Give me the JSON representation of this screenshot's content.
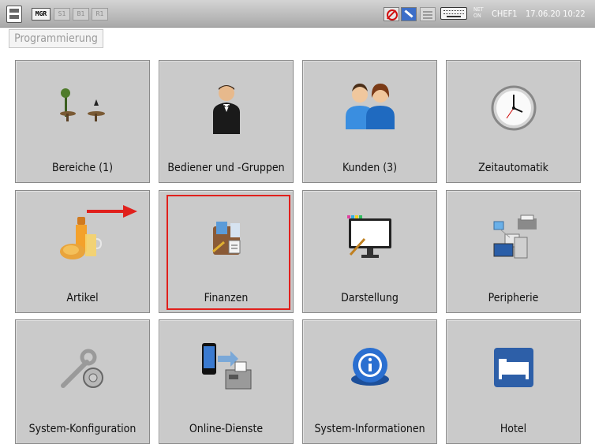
{
  "topbar": {
    "modes": [
      {
        "label": "MGR",
        "active": true
      },
      {
        "label": "S1",
        "active": false
      },
      {
        "label": "B1",
        "active": false
      },
      {
        "label": "R1",
        "active": false
      }
    ],
    "net_status": "NET ON",
    "user": "CHEF1",
    "datetime": "17.06.20  10:22"
  },
  "section_label": "Programmierung",
  "tiles": [
    {
      "label": "Bereiche (1)",
      "icon": "tables-icon"
    },
    {
      "label": "Bediener und -Gruppen",
      "icon": "waiter-icon"
    },
    {
      "label": "Kunden (3)",
      "icon": "customers-icon"
    },
    {
      "label": "Zeitautomatik",
      "icon": "clock-icon"
    },
    {
      "label": "Artikel",
      "icon": "food-drink-icon"
    },
    {
      "label": "Finanzen",
      "icon": "finance-icon"
    },
    {
      "label": "Darstellung",
      "icon": "display-icon"
    },
    {
      "label": "Peripherie",
      "icon": "peripherals-icon"
    },
    {
      "label": "System-Konfiguration",
      "icon": "tools-gear-icon"
    },
    {
      "label": "Online-Dienste",
      "icon": "phone-fax-icon"
    },
    {
      "label": "System-Informationen",
      "icon": "info-icon"
    },
    {
      "label": "Hotel",
      "icon": "bed-icon"
    }
  ],
  "annotation": {
    "arrow_color": "#e0201c",
    "highlight_color": "#e0201c"
  }
}
